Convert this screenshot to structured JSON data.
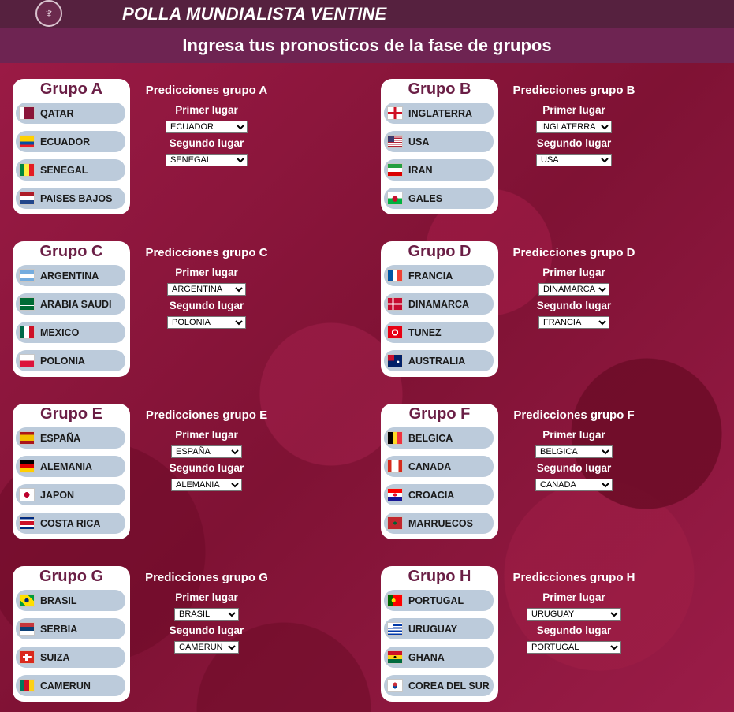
{
  "header": {
    "title": "POLLA MUNDIALISTA VENTINE",
    "subtitle": "Ingresa tus pronosticos de la fase de grupos"
  },
  "labels": {
    "first_place": "Primer lugar",
    "second_place": "Segundo lugar"
  },
  "groups": [
    {
      "title": "Grupo A",
      "pred_title": "Predicciones grupo A",
      "teams": [
        "QATAR",
        "ECUADOR",
        "SENEGAL",
        "PAISES BAJOS"
      ],
      "flags": [
        "qatar-flag-icon",
        "ecuador-flag-icon",
        "senegal-flag-icon",
        "netherlands-flag-icon"
      ],
      "first": "ECUADOR",
      "second": "SENEGAL"
    },
    {
      "title": "Grupo B",
      "pred_title": "Predicciones grupo B",
      "teams": [
        "INGLATERRA",
        "USA",
        "IRAN",
        "GALES"
      ],
      "flags": [
        "england-flag-icon",
        "usa-flag-icon",
        "iran-flag-icon",
        "wales-flag-icon"
      ],
      "first": "INGLATERRA",
      "second": "USA"
    },
    {
      "title": "Grupo C",
      "pred_title": "Predicciones grupo C",
      "teams": [
        "ARGENTINA",
        "ARABIA SAUDI",
        "MEXICO",
        "POLONIA"
      ],
      "flags": [
        "argentina-flag-icon",
        "saudi-arabia-flag-icon",
        "mexico-flag-icon",
        "poland-flag-icon"
      ],
      "first": "ARGENTINA",
      "second": "POLONIA"
    },
    {
      "title": "Grupo D",
      "pred_title": "Predicciones grupo D",
      "teams": [
        "FRANCIA",
        "DINAMARCA",
        "TUNEZ",
        "AUSTRALIA"
      ],
      "flags": [
        "france-flag-icon",
        "denmark-flag-icon",
        "tunisia-flag-icon",
        "australia-flag-icon"
      ],
      "first": "DINAMARCA",
      "second": "FRANCIA"
    },
    {
      "title": "Grupo E",
      "pred_title": "Predicciones grupo E",
      "teams": [
        "ESPAÑA",
        "ALEMANIA",
        "JAPON",
        "COSTA RICA"
      ],
      "flags": [
        "spain-flag-icon",
        "germany-flag-icon",
        "japan-flag-icon",
        "costa-rica-flag-icon"
      ],
      "first": "ESPAÑA",
      "second": "ALEMANIA"
    },
    {
      "title": "Grupo F",
      "pred_title": "Predicciones grupo F",
      "teams": [
        "BELGICA",
        "CANADA",
        "CROACIA",
        "MARRUECOS"
      ],
      "flags": [
        "belgium-flag-icon",
        "canada-flag-icon",
        "croatia-flag-icon",
        "morocco-flag-icon"
      ],
      "first": "BELGICA",
      "second": "CANADA"
    },
    {
      "title": "Grupo G",
      "pred_title": "Predicciones grupo G",
      "teams": [
        "BRASIL",
        "SERBIA",
        "SUIZA",
        "CAMERUN"
      ],
      "flags": [
        "brazil-flag-icon",
        "serbia-flag-icon",
        "switzerland-flag-icon",
        "cameroon-flag-icon"
      ],
      "first": "BRASIL",
      "second": "CAMERUN"
    },
    {
      "title": "Grupo H",
      "pred_title": "Predicciones grupo H",
      "teams": [
        "PORTUGAL",
        "URUGUAY",
        "GHANA",
        "COREA DEL SUR"
      ],
      "flags": [
        "portugal-flag-icon",
        "uruguay-flag-icon",
        "ghana-flag-icon",
        "south-korea-flag-icon"
      ],
      "first": "URUGUAY",
      "second": "PORTUGAL"
    }
  ]
}
